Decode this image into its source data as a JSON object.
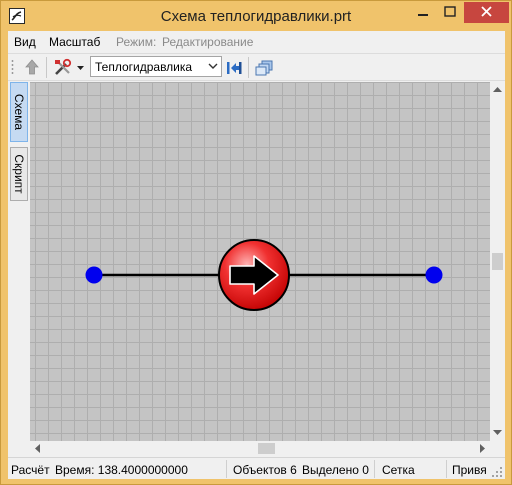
{
  "window": {
    "title": "Схема теплогидравлики.prt",
    "icon": "app-logo-icon",
    "controls": [
      "minimize-icon",
      "maximize-icon",
      "close-icon"
    ]
  },
  "menubar": {
    "items": [
      {
        "label": "Вид"
      },
      {
        "label": "Масштаб"
      },
      {
        "label": "Режим:"
      },
      {
        "label": "Редактирование"
      }
    ]
  },
  "toolbar": {
    "icons": [
      "up-arrow-icon",
      "tools-icon",
      "dropdown-arrow-icon",
      "step-into-icon",
      "windows-icon"
    ],
    "mode_select": {
      "value": "Теплогидравлика"
    }
  },
  "side_tabs": [
    {
      "label": "Схема",
      "active": true
    },
    {
      "label": "Скрипт",
      "active": false
    }
  ],
  "canvas": {
    "grid": true,
    "elements": [
      {
        "type": "node",
        "name": "left-node",
        "color": "#0000ee"
      },
      {
        "type": "pump",
        "name": "pump-element",
        "color": "#e81f1f"
      },
      {
        "type": "node",
        "name": "right-node",
        "color": "#0000ee"
      }
    ]
  },
  "statusbar": {
    "calc_label": "Расчёт",
    "time_label": "Время: 138.4000000000",
    "objects_label": "Объектов 6",
    "selected_label": "Выделено 0",
    "grid_label": "Сетка",
    "snap_label": "Привя"
  },
  "colors": {
    "titlebar": "#f0c36b",
    "close_button": "#c7463f",
    "canvas": "#c4c4c4",
    "node": "#0000ee",
    "pump": "#e81f1f"
  }
}
